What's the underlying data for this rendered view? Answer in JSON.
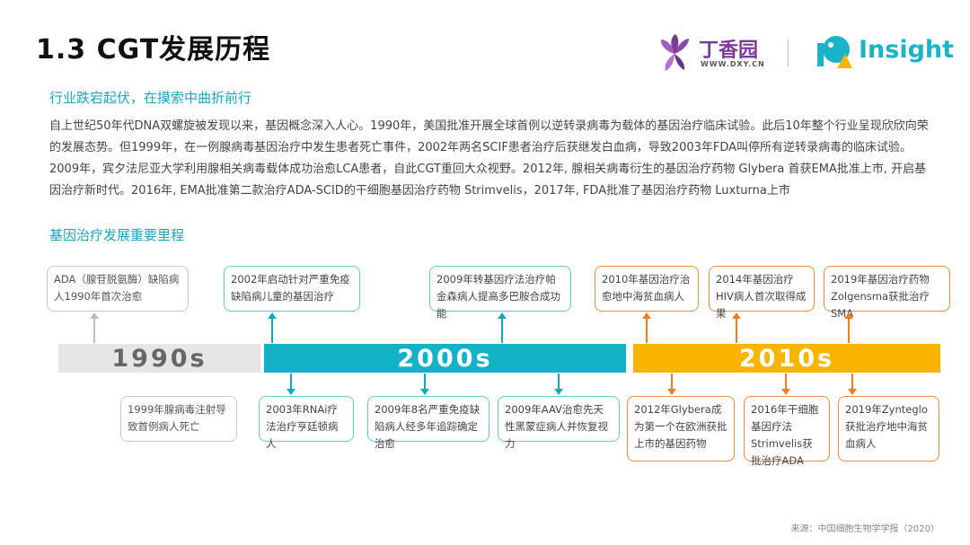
{
  "header": {
    "title": "1.3 CGT发展历程",
    "logo_dxy_name": "丁香园",
    "logo_dxy_url": "WWW.DXY.CN",
    "logo_insight": "Insight"
  },
  "intro": {
    "subtitle": "行业跌宕起伏，在摸索中曲折前行",
    "paragraph": "自上世纪50年代DNA双螺旋被发现以来，基因概念深入人心。1990年，美国批准开展全球首例以逆转录病毒为载体的基因治疗临床试验。此后10年整个行业呈现欣欣向荣的发展态势。但1999年，在一例腺病毒基因治疗中发生患者死亡事件，2002年两名SCIF患者治疗后获继发白血病，导致2003年FDA叫停所有逆转录病毒的临床试验。2009年，宾夕法尼亚大学利用腺相关病毒载体成功治愈LCA患者，自此CGT重回大众视野。2012年, 腺相关病毒衍生的基因治疗药物 Glybera 首获EMA批准上市, 开启基因治疗新时代。2016年, EMA批准第二款治疗ADA-SCID的干细胞基因治疗药物 Strimvelis，2017年, FDA批准了基因治疗药物 Luxturna上市"
  },
  "timeline": {
    "heading": "基因治疗发展重要里程",
    "eras": [
      "1990s",
      "2000s",
      "2010s"
    ],
    "events_top": [
      "ADA（腺苷脱氨酶）缺陷病人1990年首次治愈",
      "2002年启动针对严重免疫缺陷病儿童的基因治疗",
      "2009年转基因疗法治疗帕金森病人提高多巴胺合成功能",
      "2010年基因治疗治愈地中海贫血病人",
      "2014年基因治疗HIV病人首次取得成果",
      "2019年基因治疗药物Zolgensma获批治疗SMA"
    ],
    "events_bottom": [
      "1999年腺病毒注射导致首例病人死亡",
      "2003年RNAi疗法治疗亨廷顿病人",
      "2009年8名严重免疫缺陷病人经多年追踪确定治愈",
      "2009年AAV治愈先天性黑蒙症病人并恢复视力",
      "2012年Glybera成为第一个在欧洲获批上市的基因药物",
      "2016年干细胞基因疗法Strimvelis获批治疗ADA",
      "2019年Zynteglo获批治疗地中海贫血病人"
    ]
  },
  "footer": {
    "source": "来源：中国细胞生物学学报（2020）"
  },
  "colors": {
    "era_1990s": "#e6e6e6",
    "era_2000s": "#14b2c9",
    "era_2010s": "#f7b500",
    "accent_teal": "#1aa6bd",
    "accent_orange": "#ef7d22"
  }
}
